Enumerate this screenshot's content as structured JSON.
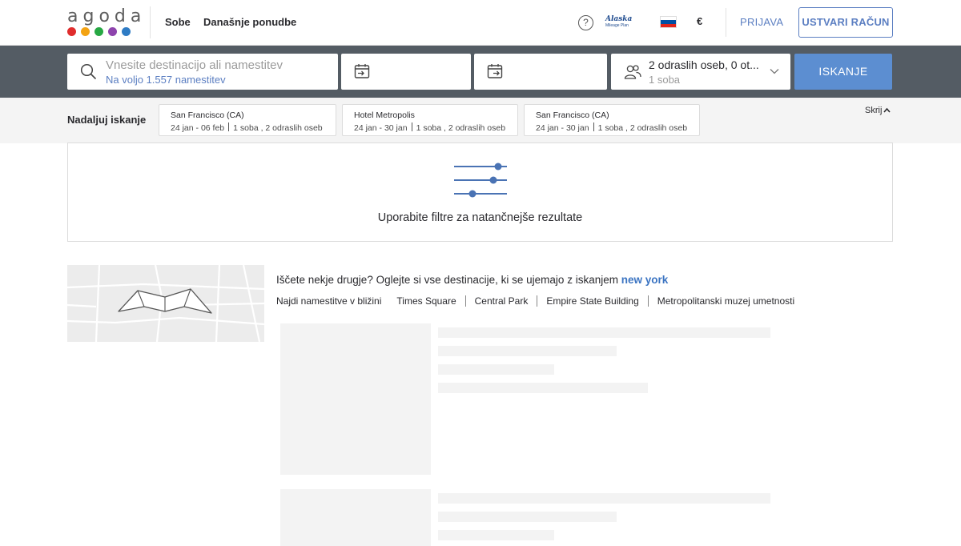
{
  "header": {
    "logo_text": "agoda",
    "logo_colors": [
      "#e02d2d",
      "#f3a313",
      "#27a844",
      "#8e44ad",
      "#2e7bc4"
    ],
    "nav": [
      "Sobe",
      "Današnje ponudbe"
    ],
    "help_glyph": "?",
    "partner_logo_text": "Alaska",
    "partner_logo_sub": "Mileage Plan",
    "flag_colors": [
      "#ffffff",
      "#0050a4",
      "#e1251b"
    ],
    "currency": "€",
    "login_label": "PRIJAVA",
    "signup_label": "USTVARI RAČUN"
  },
  "search": {
    "destination_placeholder": "Vnesite destinacijo ali namestitev",
    "destination_count": "Na voljo 1.557 namestitev",
    "guests_main": "2 odraslih oseb, 0 ot...",
    "guests_sub": "1 soba",
    "search_label": "ISKANJE",
    "icons": [
      "search-icon",
      "calendar-checkin-icon",
      "calendar-checkout-icon",
      "people-icon",
      "chevron-down-icon"
    ]
  },
  "continue_search": {
    "label": "Nadaljuj iskanje",
    "hide_label": "Skrij",
    "cards": [
      {
        "title": "San Francisco (CA)",
        "dates": "24 jan - 06 feb",
        "details": "1 soba , 2 odraslih oseb"
      },
      {
        "title": "Hotel Metropolis",
        "dates": "24 jan - 30 jan",
        "details": "1 soba , 2 odraslih oseb"
      },
      {
        "title": "San Francisco (CA)",
        "dates": "24 jan - 30 jan",
        "details": "1 soba , 2 odraslih oseb"
      }
    ]
  },
  "filters": {
    "message": "Uporabite filtre za natančnejše rezultate",
    "icon": "sliders-icon"
  },
  "destinations": {
    "question": "Iščete nekje drugje? Oglejte si vse destinacije, ki se ujemajo z iskanjem",
    "keyword": "new york",
    "nearby_label": "Najdi namestitve v bližini",
    "nearby_places": [
      "Times Square",
      "Central Park",
      "Empire State Building",
      "Metropolitanski muzej umetnosti"
    ]
  },
  "colors": {
    "accent": "#5c8ed1",
    "link": "#5c7fc2",
    "searchbar_bg": "#545c64"
  }
}
